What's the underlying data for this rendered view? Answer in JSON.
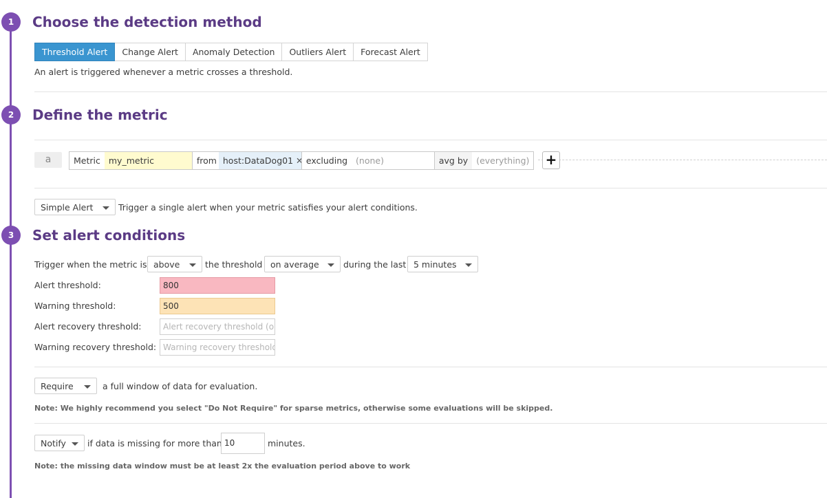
{
  "steps": [
    {
      "number": "1",
      "title": "Choose the detection method"
    },
    {
      "number": "2",
      "title": "Define the metric"
    },
    {
      "number": "3",
      "title": "Set alert conditions"
    }
  ],
  "detection": {
    "tabs": [
      "Threshold Alert",
      "Change Alert",
      "Anomaly Detection",
      "Outliers Alert",
      "Forecast Alert"
    ],
    "active_tab": "Threshold Alert",
    "description": "An alert is triggered whenever a metric crosses a threshold."
  },
  "query": {
    "letter": "a",
    "metric_label": "Metric",
    "metric_value": "my_metric",
    "from_label": "from",
    "from_tag": "host:DataDog01",
    "remove_tag_glyph": "✕",
    "excluding_label": "excluding",
    "excluding_value": "(none)",
    "avg_by_label": "avg by",
    "avg_by_value": "(everything)",
    "add_glyph": "+"
  },
  "alert_type": {
    "selected": "Simple Alert",
    "description": "Trigger a single alert when your metric satisfies your alert conditions."
  },
  "conditions": {
    "trigger_prefix": "Trigger when the metric is",
    "comparison": "above",
    "threshold_text": "the threshold",
    "aggregation": "on average",
    "during_text": "during the last",
    "window": "5 minutes",
    "alert_threshold_label": "Alert threshold:",
    "alert_threshold_value": "800",
    "warning_threshold_label": "Warning threshold:",
    "warning_threshold_value": "500",
    "alert_recovery_label": "Alert recovery threshold:",
    "alert_recovery_placeholder": "Alert recovery threshold (optional)",
    "warning_recovery_label": "Warning recovery threshold:",
    "warning_recovery_placeholder": "Warning recovery threshold (optional)"
  },
  "data_window": {
    "selected": "Require",
    "text": "a full window of data for evaluation.",
    "note": "Note: We highly recommend you select \"Do Not Require\" for sparse metrics, otherwise some evaluations will be skipped."
  },
  "missing_data": {
    "selected": "Notify",
    "text_before": "if data is missing for more than",
    "minutes_value": "10",
    "text_after": "minutes.",
    "note": "Note: the missing data window must be at least 2x the evaluation period above to work"
  },
  "colors": {
    "step_purple": "#7d4fb2",
    "title_purple": "#5b3b85",
    "active_tab_blue": "#3a95d0",
    "alert_threshold_bg": "#f9b8c1",
    "warning_threshold_bg": "#fde3b6",
    "metric_bg": "#fffbcf",
    "tag_bg": "#e5f0f9"
  }
}
